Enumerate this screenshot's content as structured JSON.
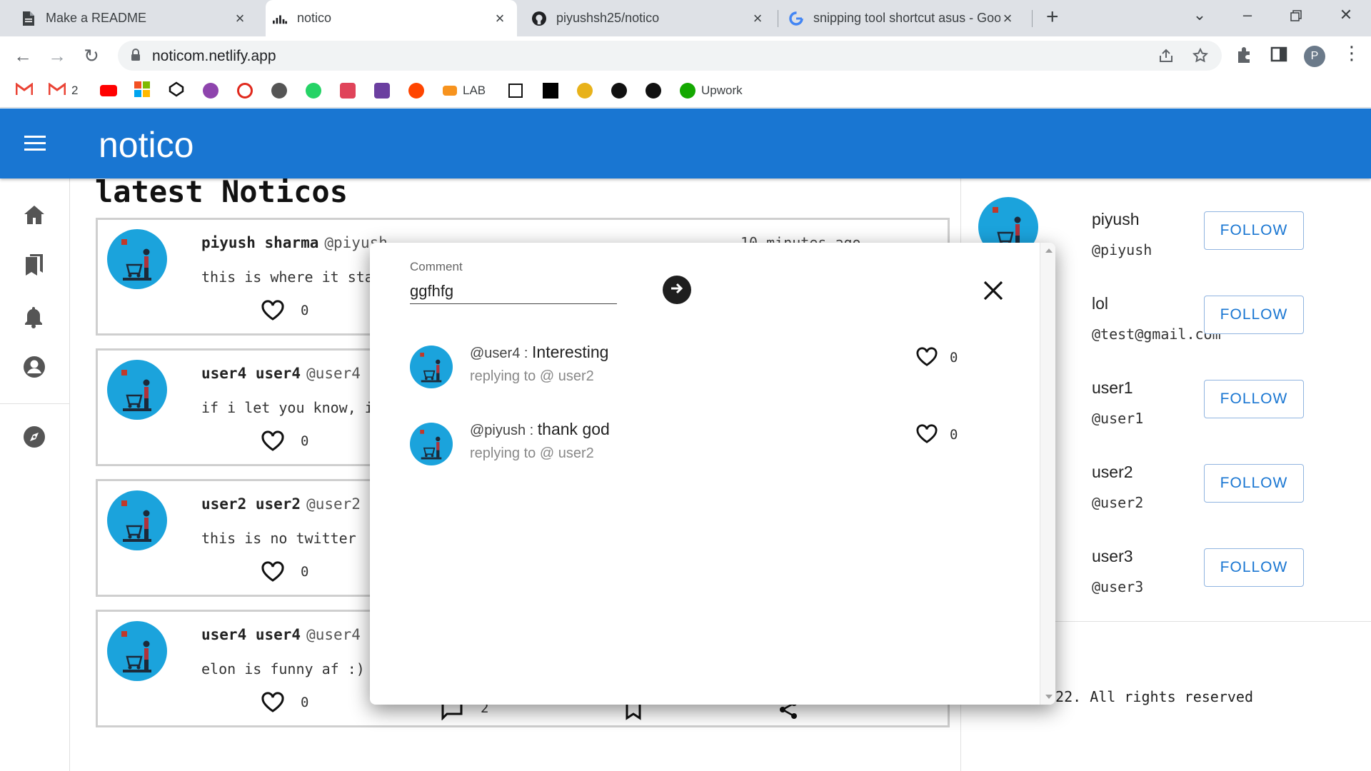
{
  "browser": {
    "tabs": [
      {
        "title": "Make a README",
        "icon": "document-icon"
      },
      {
        "title": "notico",
        "icon": "chart-icon"
      },
      {
        "title": "piyushsh25/notico",
        "icon": "github-icon"
      },
      {
        "title": "snipping tool shortcut asus - Goo",
        "icon": "google-icon"
      }
    ],
    "url": "noticom.netlify.app",
    "profile_initial": "P",
    "bookmarks": {
      "gmail_count": "2",
      "lab": "LAB",
      "upwork": "Upwork"
    }
  },
  "app": {
    "title": "notico",
    "feed_title": "latest Noticos",
    "posts": [
      {
        "name": "piyush sharma",
        "handle": "@piyush",
        "time": "10 minutes ago",
        "body": "this is where it sta",
        "likes": "0",
        "comments": ""
      },
      {
        "name": "user4 user4",
        "handle": "@user4",
        "time": "",
        "body": "if i let you know, i",
        "likes": "0",
        "comments": ""
      },
      {
        "name": "user2 user2",
        "handle": "@user2",
        "time": "",
        "body": "this is no twitter",
        "likes": "0",
        "comments": ""
      },
      {
        "name": "user4 user4",
        "handle": "@user4",
        "time": "",
        "body": "elon is funny af :)",
        "likes": "0",
        "comments": "2"
      }
    ],
    "suggestions": [
      {
        "name": "piyush",
        "handle": "@piyush",
        "button": "FOLLOW"
      },
      {
        "name": "lol",
        "handle": "@test@gmail.com",
        "button": "FOLLOW"
      },
      {
        "name": "user1",
        "handle": "@user1",
        "button": "FOLLOW"
      },
      {
        "name": "user2",
        "handle": "@user2",
        "button": "FOLLOW"
      },
      {
        "name": "user3",
        "handle": "@user3",
        "button": "FOLLOW"
      }
    ],
    "footer": "022. All rights reserved"
  },
  "modal": {
    "label": "Comment",
    "input_value": "ggfhfg",
    "replies": [
      {
        "user": "@user4",
        "sep": " : ",
        "text": "Interesting",
        "replying": "replying to @ user2",
        "likes": "0"
      },
      {
        "user": "@piyush",
        "sep": " : ",
        "text": "thank god",
        "replying": "replying to @ user2",
        "likes": "0"
      }
    ]
  },
  "colors": {
    "appbar": "#1976d2",
    "avatar_bg": "#1ba3dc",
    "follow_text": "#1976d2"
  }
}
